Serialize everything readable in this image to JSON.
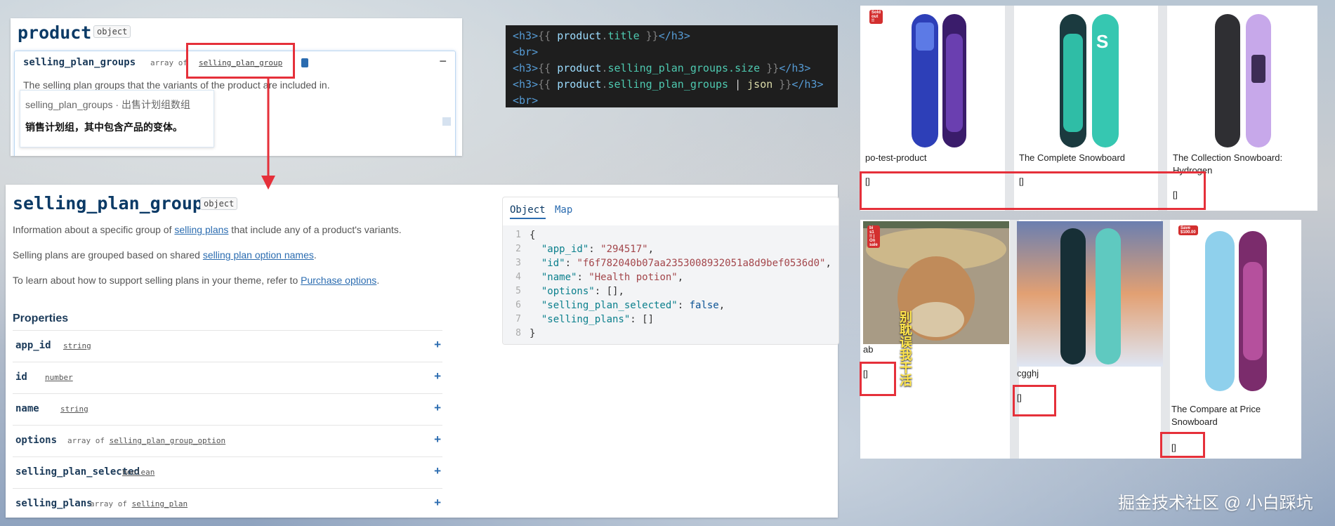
{
  "product_panel": {
    "title": "product",
    "badge": "object",
    "row_name": "selling_plan_groups",
    "row_type_prefix": "array of",
    "row_type_link": "selling_plan_group",
    "row_desc": "The selling plan groups that the variants of the product are included in.",
    "tooltip_title": "selling_plan_groups · 出售计划组数组",
    "tooltip_body": "销售计划组，其中包含产品的变体。"
  },
  "code_panel": {
    "line1": {
      "open": "<h3>",
      "open_braces": "{{ ",
      "obj": "product",
      "dot": ".",
      "prop": "title",
      "close_braces": " }}",
      "close": "</h3>"
    },
    "line2": "<br>",
    "line3": {
      "open": "<h3>",
      "open_braces": "{{ ",
      "obj": "product",
      "dot": ".",
      "prop": "selling_plan_groups.size",
      "close_braces": " }}",
      "close": "</h3>"
    },
    "line4": {
      "open": "<h3>",
      "open_braces": "{{ ",
      "obj": "product",
      "dot": ".",
      "prop": "selling_plan_groups",
      "pipe": " | ",
      "filter": "json",
      "close_braces": " }}",
      "close": "</h3>"
    },
    "line5": "<br>"
  },
  "spg_panel": {
    "title": "selling_plan_group",
    "badge": "object",
    "p1_a": "Information about a specific group of ",
    "p1_link": "selling plans",
    "p1_b": " that include any of a product's variants.",
    "p2_a": "Selling plans are grouped based on shared ",
    "p2_link": "selling plan option names",
    "p2_b": ".",
    "p3_a": "To learn about how to support selling plans in your theme, refer to ",
    "p3_link": "Purchase options",
    "p3_b": ".",
    "properties_heading": "Properties",
    "properties": [
      {
        "name": "app_id",
        "type": "string",
        "prefix": ""
      },
      {
        "name": "id",
        "type": "number",
        "prefix": ""
      },
      {
        "name": "name",
        "type": "string",
        "prefix": ""
      },
      {
        "name": "options",
        "type": "selling_plan_group_option",
        "prefix": "array of "
      },
      {
        "name": "selling_plan_selected",
        "type": "boolean",
        "prefix": ""
      },
      {
        "name": "selling_plans",
        "type": "selling_plan",
        "prefix": "array of "
      }
    ],
    "tabs": [
      "Object",
      "Map"
    ],
    "json_lines": [
      {
        "n": "1",
        "text": "{"
      },
      {
        "n": "2",
        "key": "\"app_id\"",
        "val": "\"294517\"",
        "kind": "str"
      },
      {
        "n": "3",
        "key": "\"id\"",
        "val": "\"f6f782040b07aa2353008932051a8d9bef0536d0\"",
        "kind": "str"
      },
      {
        "n": "4",
        "key": "\"name\"",
        "val": "\"Health potion\"",
        "kind": "str"
      },
      {
        "n": "5",
        "key": "\"options\"",
        "val": "[]",
        "kind": "plain"
      },
      {
        "n": "6",
        "key": "\"selling_plan_selected\"",
        "val": "false",
        "kind": "kw"
      },
      {
        "n": "7",
        "key": "\"selling_plans\"",
        "val": "[]",
        "kind": "plain",
        "last": true
      },
      {
        "n": "8",
        "text": "}"
      }
    ]
  },
  "products": [
    {
      "name": "po-test-product",
      "value": "[]",
      "tag": "Sold out !!"
    },
    {
      "name": "The Complete Snowboard",
      "value": "[]",
      "tag": ""
    },
    {
      "name": "The Collection Snowboard: Hydrogen",
      "value": "[]",
      "tag": ""
    },
    {
      "name": "ab",
      "value": "[]",
      "tag": "bi s1 !! | On sale",
      "image_caption": "别耽误我干活"
    },
    {
      "name": "cgghj",
      "value": "[]",
      "tag": ""
    },
    {
      "name": "The Compare at Price Snowboard",
      "value": "[]",
      "tag": "Save $100.00"
    }
  ],
  "watermark": "掘金技术社区 @ 小白踩坑",
  "colors": {
    "highlight": "#e5303a",
    "link": "#2b6cb0",
    "heading": "#0b3a66"
  }
}
